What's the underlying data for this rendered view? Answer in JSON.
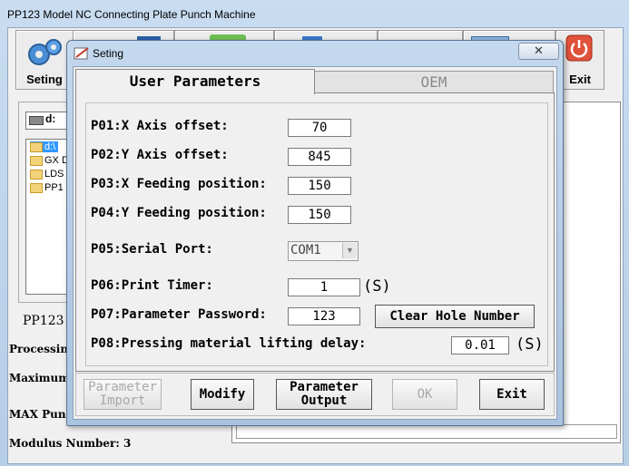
{
  "main_window": {
    "title": "PP123 Model NC Connecting Plate Punch Machine",
    "toolbar": {
      "setting_label": "Seting",
      "exit_label": "Exit"
    },
    "drive": {
      "selected": "d:"
    },
    "folders": [
      "d:\\",
      "GX D",
      "LDS",
      "PP1"
    ],
    "left_info": {
      "model_label": "PP123",
      "processing_label": "Processin",
      "maximum_label": "Maximum",
      "max_punch_label": "MAX Punc",
      "modulus_label": "Modulus Number: 3"
    }
  },
  "dialog": {
    "title": "Seting",
    "close_icon": "close-icon",
    "tabs": {
      "user": "User Parameters",
      "oem": "OEM"
    },
    "params": {
      "p01": {
        "label": "P01:X Axis offset:",
        "value": "70"
      },
      "p02": {
        "label": "P02:Y Axis offset:",
        "value": "845"
      },
      "p03": {
        "label": "P03:X Feeding position:",
        "value": "150"
      },
      "p04": {
        "label": "P04:Y Feeding position:",
        "value": "150"
      },
      "p05": {
        "label": "P05:Serial Port:",
        "value": "COM1"
      },
      "p06": {
        "label": "P06:Print Timer:",
        "value": "1",
        "unit": "(S)"
      },
      "p07": {
        "label": "P07:Parameter Password:",
        "value": "123"
      },
      "p08": {
        "label": "P08:Pressing material lifting delay:",
        "value": "0.01",
        "unit": "(S)"
      }
    },
    "clear_hole_button": "Clear Hole Number",
    "buttons": {
      "import": "Parameter Import",
      "modify": "Modify",
      "output": "Parameter Output",
      "ok": "OK",
      "exit": "Exit"
    }
  }
}
